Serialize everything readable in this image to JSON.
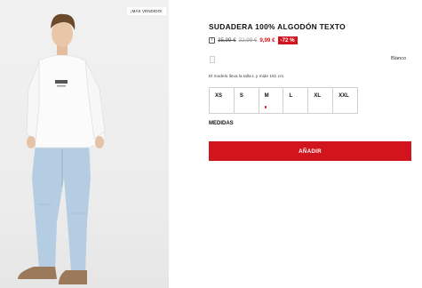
{
  "product_image": {
    "badge": "¡MÁS VENDIDO!"
  },
  "product": {
    "title": "SUDADERA 100% ALGODÓN TEXTO",
    "info_icon_text": "i",
    "price_original": "35,99 €",
    "price_previous": "22,99 €",
    "price_current": "9,99 €",
    "discount": "-72 %"
  },
  "color": {
    "name": "Blanco",
    "swatch_hex": "#fafafa"
  },
  "model_note": "El modelo lleva la talla L y mide 181 cm.",
  "sizes": [
    {
      "label": "XS",
      "low_stock": false
    },
    {
      "label": "S",
      "low_stock": false
    },
    {
      "label": "M",
      "low_stock": true
    },
    {
      "label": "L",
      "low_stock": false
    },
    {
      "label": "XL",
      "low_stock": false
    },
    {
      "label": "XXL",
      "low_stock": false
    }
  ],
  "measures_label": "MEDIDAS",
  "add_button_label": "AÑADIR",
  "colors": {
    "accent": "#d2141c"
  }
}
